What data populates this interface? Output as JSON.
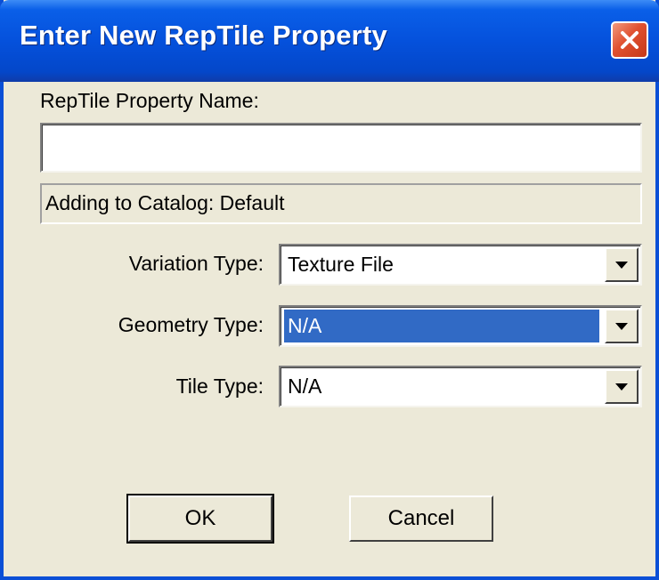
{
  "dialog": {
    "title": "Enter New RepTile Property",
    "close_icon": "close-icon"
  },
  "form": {
    "name_label": "RepTile Property Name:",
    "name_value": "",
    "catalog_status": "Adding to Catalog: Default",
    "variation_label": "Variation Type:",
    "variation_value": "Texture File",
    "geometry_label": "Geometry Type:",
    "geometry_value": "N/A",
    "tile_label": "Tile Type:",
    "tile_value": "N/A"
  },
  "buttons": {
    "ok": "OK",
    "cancel": "Cancel"
  },
  "colors": {
    "titlebar": "#0551dc",
    "close": "#e0502f",
    "selection": "#316ac5",
    "face": "#ece9d8"
  }
}
